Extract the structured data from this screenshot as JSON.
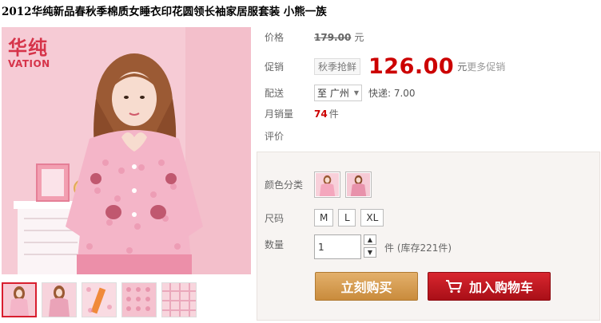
{
  "product": {
    "title": "2012华纯新品春秋季棉质女睡衣印花圆领长袖家居服套装 小熊一族"
  },
  "brand": {
    "logo_cn": "华纯",
    "logo_en": "VATION"
  },
  "price": {
    "label": "价格",
    "original": "179.00",
    "unit": "元"
  },
  "promo": {
    "label": "促销",
    "tag": "秋季抢鲜",
    "price": "126.00",
    "unit": "元",
    "more": "更多促销"
  },
  "shipping": {
    "label": "配送",
    "destination": "至 广州",
    "fee": "快递: 7.00"
  },
  "sales": {
    "label": "月销量",
    "count": "74",
    "unit": "件"
  },
  "review": {
    "label": "评价"
  },
  "options": {
    "color_label": "颜色分类",
    "size_label": "尺码",
    "sizes": [
      "M",
      "L",
      "XL"
    ],
    "qty_label": "数量",
    "qty_value": "1",
    "stock_text": "件 (库存221件)"
  },
  "actions": {
    "buy_now": "立刻购买",
    "add_to_cart": "加入购物车"
  },
  "colors": {
    "price_red": "#cc0000",
    "buy_button": "#c98b3c",
    "cart_button": "#b8141c",
    "logo_red": "#d6344a"
  }
}
